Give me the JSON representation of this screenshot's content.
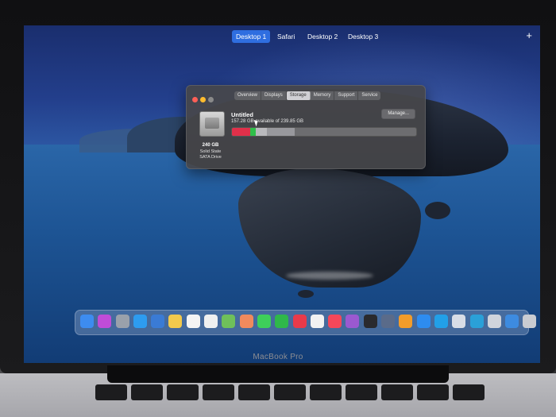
{
  "spaces": {
    "items": [
      {
        "label": "Desktop 1",
        "active": true
      },
      {
        "label": "Safari",
        "active": false
      },
      {
        "label": "Desktop 2",
        "active": false
      },
      {
        "label": "Desktop 3",
        "active": false
      }
    ],
    "add_label": "+"
  },
  "about_window": {
    "tabs": [
      "Overview",
      "Displays",
      "Storage",
      "Memory",
      "Support",
      "Service"
    ],
    "selected_tab": "Storage",
    "volume_name": "Untitled",
    "available_text": "157.28 GB available of 239.85 GB",
    "manage_label": "Manage...",
    "disk_size": "240 GB",
    "disk_type_line1": "Solid State",
    "disk_type_line2": "SATA Drive",
    "storage_bar": [
      {
        "color": "#e0304a",
        "fraction": 0.1
      },
      {
        "color": "#2fbf4a",
        "fraction": 0.03
      },
      {
        "color": "#b9b9bd",
        "fraction": 0.06
      },
      {
        "color": "#98989d",
        "fraction": 0.15
      }
    ]
  },
  "dock": {
    "icons": [
      {
        "name": "finder-icon",
        "color": "#3d8cf0"
      },
      {
        "name": "siri-icon",
        "color": "#c04cd8"
      },
      {
        "name": "launchpad-icon",
        "color": "#9aa1ab"
      },
      {
        "name": "safari-icon",
        "color": "#2d9cf0"
      },
      {
        "name": "photo-icon",
        "color": "#3a7bd5"
      },
      {
        "name": "notes-icon",
        "color": "#f2c94c"
      },
      {
        "name": "calendar-icon",
        "color": "#f4f4f4"
      },
      {
        "name": "reminders-icon",
        "color": "#f0f0f0"
      },
      {
        "name": "maps-icon",
        "color": "#6fc05a"
      },
      {
        "name": "photos-icon",
        "color": "#f08a5d"
      },
      {
        "name": "messages-icon",
        "color": "#3ecf5a"
      },
      {
        "name": "facetime-icon",
        "color": "#2fb84a"
      },
      {
        "name": "news-icon",
        "color": "#e83a4a"
      },
      {
        "name": "stop-icon",
        "color": "#f2f2f2"
      },
      {
        "name": "music-icon",
        "color": "#f5475a"
      },
      {
        "name": "podcasts-icon",
        "color": "#9b59d0"
      },
      {
        "name": "tv-icon",
        "color": "#2a2a2e"
      },
      {
        "name": "help-icon",
        "color": "#5a6b8a"
      },
      {
        "name": "books-icon",
        "color": "#f39c2a"
      },
      {
        "name": "app-store-icon",
        "color": "#2d8cf0"
      },
      {
        "name": "system-preferences-icon",
        "color": "#22a0e8"
      },
      {
        "name": "preview-icon",
        "color": "#d8dde6"
      },
      {
        "name": "downloads-icon",
        "color": "#2aa0d8"
      },
      {
        "name": "documents-icon",
        "color": "#d0d4dc"
      },
      {
        "name": "folder-icon",
        "color": "#3d8be0"
      },
      {
        "name": "trash-icon",
        "color": "#c9ccd2"
      }
    ]
  },
  "brand": "MacBook Pro"
}
